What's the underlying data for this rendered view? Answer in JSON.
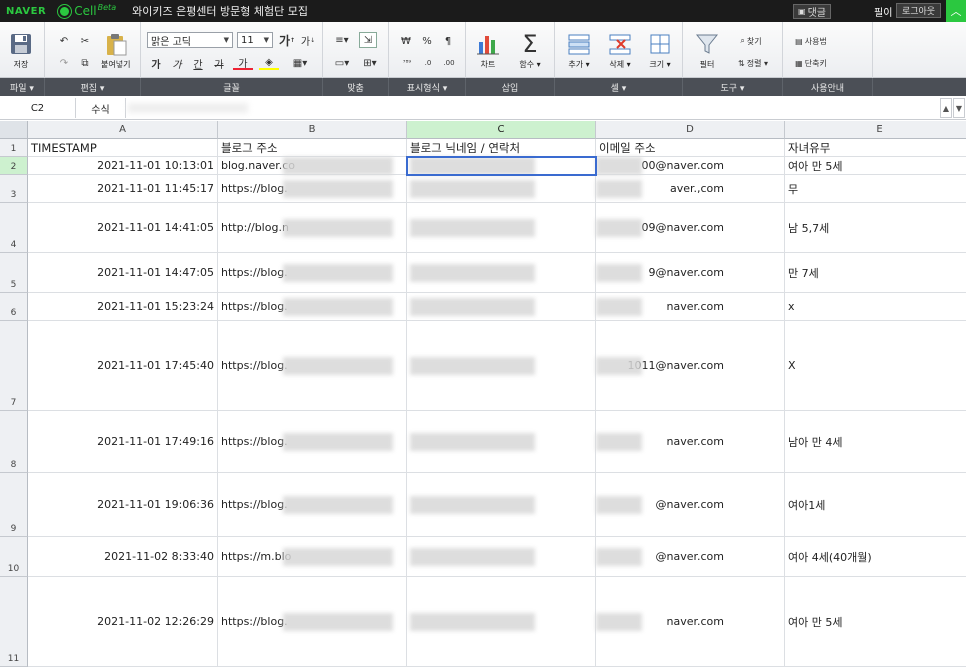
{
  "app": {
    "naver_logo": "NAVER",
    "cell_logo": "Cell",
    "cell_beta": "Beta",
    "doc_title": "와이키즈 은평센터 방문형 체험단 모집",
    "reply_label": "댓글",
    "user_name": "필이",
    "logout_label": "로그아웃"
  },
  "ribbon": {
    "save": "저장",
    "paste": "붙여넣기",
    "font_name": "맑은 고딕",
    "font_size": "11",
    "bold": "가",
    "italic": "가",
    "underline": "간",
    "strike": "가",
    "font_color_glyph": "가",
    "chart": "차트",
    "function": "함수 ▾",
    "insert_row": "추가 ▾",
    "delete_row": "삭제 ▾",
    "size": "크기 ▾",
    "filter": "필터",
    "find": "찾기",
    "sort": "정렬 ▾",
    "usage": "사용법",
    "shortcut": "단축키",
    "currency": "₩",
    "percent": "%",
    "comma": "¶"
  },
  "group_labels": [
    "파일 ▾",
    "편집 ▾",
    "글꼴",
    "맞춤",
    "표시형식 ▾",
    "삽입",
    "셀 ▾",
    "도구 ▾",
    "사용안내"
  ],
  "formula_bar": {
    "name_box": "C2",
    "fx_label": "수식"
  },
  "columns": [
    "A",
    "B",
    "C",
    "D",
    "E"
  ],
  "row_numbers": [
    "1",
    "2",
    "3",
    "4",
    "5",
    "6",
    "7",
    "8",
    "9",
    "10",
    "11"
  ],
  "header_row": [
    "TIMESTAMP",
    "블로그 주소",
    "블로그 닉네임 / 연락처",
    "이메일 주소",
    "자녀유무"
  ],
  "rows": [
    {
      "timestamp": "2021-11-01 10:13:01",
      "url": "blog.naver.co",
      "email": "00@naver.com",
      "children": "여아 만 5세"
    },
    {
      "timestamp": "2021-11-01 11:45:17",
      "url": "https://blog.",
      "email": "aver.,com",
      "children": "무"
    },
    {
      "timestamp": "2021-11-01 14:41:05",
      "url": "http://blog.n",
      "email": "09@naver.com",
      "children": "남 5,7세"
    },
    {
      "timestamp": "2021-11-01 14:47:05",
      "url": "https://blog.",
      "email": "9@naver.com",
      "children": "만 7세"
    },
    {
      "timestamp": "2021-11-01 15:23:24",
      "url": "https://blog.",
      "email": "naver.com",
      "children": "x"
    },
    {
      "timestamp": "2021-11-01 17:45:40",
      "url": "https://blog.",
      "email": "1011@naver.com",
      "children": "X"
    },
    {
      "timestamp": "2021-11-01 17:49:16",
      "url": "https://blog.",
      "email": "naver.com",
      "children": "남아 만 4세"
    },
    {
      "timestamp": "2021-11-01 19:06:36",
      "url": "https://blog.",
      "email": "@naver.com",
      "children": "여아1세"
    },
    {
      "timestamp": "2021-11-02 8:33:40",
      "url": "https://m.blo",
      "email": "@naver.com",
      "children": "여아 4세(40개월)"
    },
    {
      "timestamp": "2021-11-02 12:26:29",
      "url": "https://blog.",
      "email": "naver.com",
      "children": "여아 만 5세"
    }
  ],
  "colors": {
    "accent": "#2bc840",
    "topbar": "#1b1b1b",
    "selection": "#3a6bd0",
    "selected_header": "#cdf1cf"
  },
  "icons": [
    "save-icon",
    "undo-icon",
    "redo-icon",
    "cut-icon",
    "copy-icon",
    "paste-icon",
    "chart-icon",
    "sigma-icon",
    "filter-icon",
    "find-icon"
  ]
}
